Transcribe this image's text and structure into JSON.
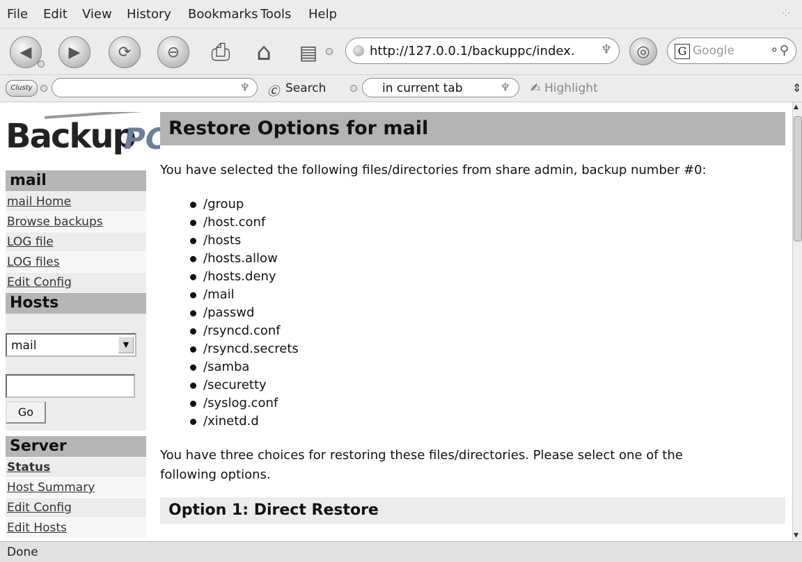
{
  "menu": [
    "File",
    "Edit",
    "View",
    "History",
    "Bookmarks",
    "Tools",
    "Help"
  ],
  "nav": {
    "url": "http://127.0.0.1/backuppc/index.",
    "search_placeholder": "Google"
  },
  "toolbar2": {
    "logo_label": "Clusty",
    "search_label": "Search",
    "tab_option": "in current tab",
    "highlight_label": "Highlight"
  },
  "sidebar": {
    "logo_text": "Backup",
    "logo_suffix": "PC",
    "host_header": "mail",
    "host_links": [
      "mail Home",
      "Browse backups",
      "LOG file",
      "LOG files",
      "Edit Config"
    ],
    "hosts_header": "Hosts",
    "host_select_value": "mail",
    "go_label": "Go",
    "server_header": "Server",
    "server_links": [
      "Status",
      "Host Summary",
      "Edit Config",
      "Edit Hosts"
    ]
  },
  "main": {
    "title": "Restore Options for mail",
    "intro": "You have selected the following files/directories from share admin, backup number #0:",
    "files": [
      "/group",
      "/host.conf",
      "/hosts",
      "/hosts.allow",
      "/hosts.deny",
      "/mail",
      "/passwd",
      "/rsyncd.conf",
      "/rsyncd.secrets",
      "/samba",
      "/securetty",
      "/syslog.conf",
      "/xinetd.d"
    ],
    "choices_line1": "You have three choices for restoring these files/directories. Please select one of the",
    "choices_line2": "following options.",
    "option1_title": "Option 1: Direct Restore"
  },
  "status": "Done"
}
